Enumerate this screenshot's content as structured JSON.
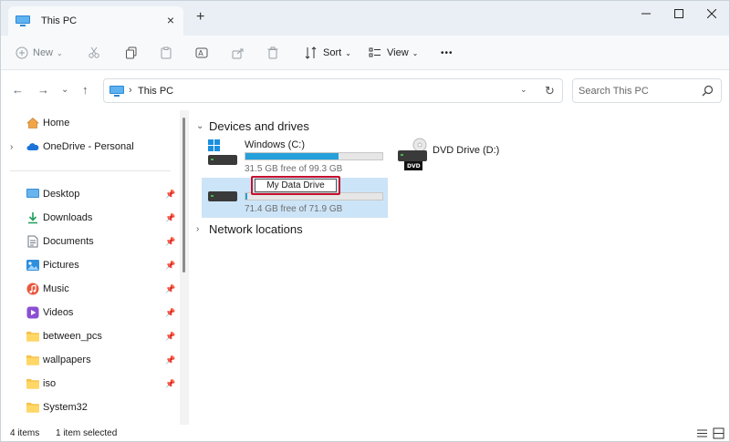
{
  "window": {
    "tab_title": "This PC",
    "new_tab": "+",
    "close_tab": "×"
  },
  "toolbar": {
    "new_label": "New",
    "sort_label": "Sort",
    "view_label": "View",
    "more": "•••"
  },
  "address": {
    "path": "This PC",
    "separator": "›",
    "search_placeholder": "Search This PC"
  },
  "sidebar": {
    "items": [
      {
        "label": "Home",
        "icon": "home-icon"
      },
      {
        "label": "OneDrive - Personal",
        "icon": "cloud-icon"
      },
      {
        "label": "Desktop",
        "icon": "desktop-folder-icon"
      },
      {
        "label": "Downloads",
        "icon": "download-icon"
      },
      {
        "label": "Documents",
        "icon": "document-icon"
      },
      {
        "label": "Pictures",
        "icon": "pictures-icon"
      },
      {
        "label": "Music",
        "icon": "music-icon"
      },
      {
        "label": "Videos",
        "icon": "video-icon"
      },
      {
        "label": "between_pcs",
        "icon": "folder-icon"
      },
      {
        "label": "wallpapers",
        "icon": "folder-icon"
      },
      {
        "label": "iso",
        "icon": "folder-icon"
      },
      {
        "label": "System32",
        "icon": "folder-icon"
      }
    ]
  },
  "content": {
    "devices_header": "Devices and drives",
    "network_header": "Network locations",
    "drives": [
      {
        "name": "Windows (C:)",
        "free": "31.5 GB free of 99.3 GB",
        "used_fraction": 0.68
      },
      {
        "name": "DVD Drive (D:)",
        "badge": "DVD"
      },
      {
        "name": "My Data Drive",
        "free": "71.4 GB free of 71.9 GB",
        "used_fraction": 0.01
      }
    ]
  },
  "status": {
    "items_count": "4 items",
    "selected": "1 item selected"
  },
  "colors": {
    "accent": "#26a0da",
    "selection": "#cce4f7",
    "highlight": "#c8102e"
  }
}
